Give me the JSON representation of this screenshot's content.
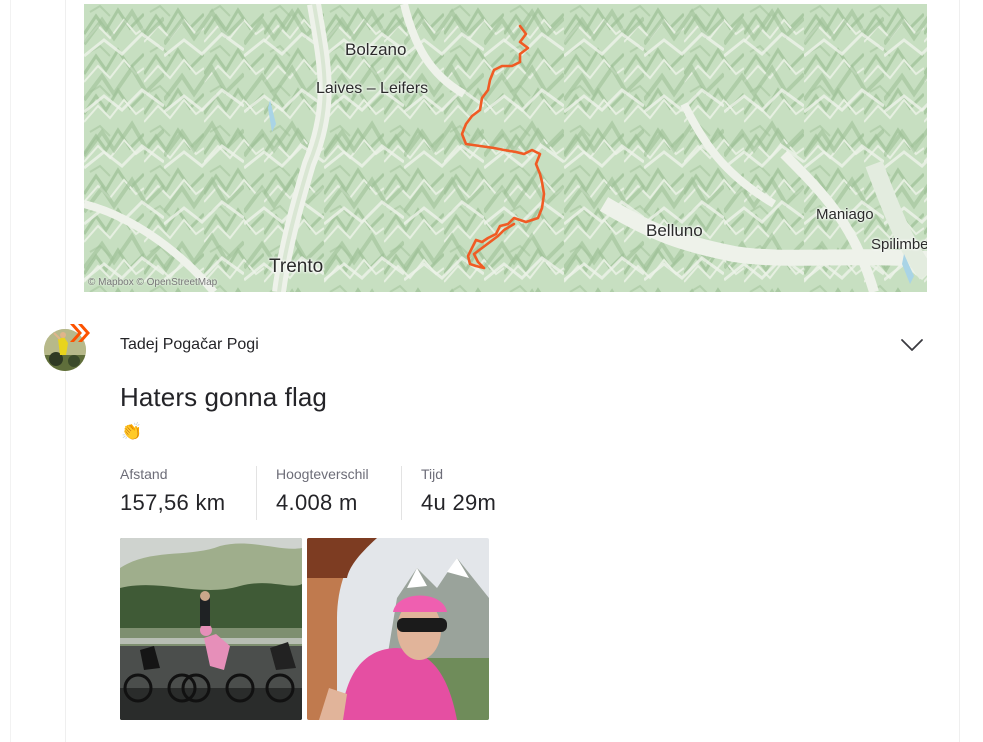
{
  "map": {
    "labels": {
      "bolzano": "Bolzano",
      "laives": "Laives – Leifers",
      "trento": "Trento",
      "belluno": "Belluno",
      "maniago": "Maniago",
      "spilimbergo": "Spilimbe"
    },
    "credit": "© Mapbox © OpenStreetMap",
    "route_color": "#f05b24"
  },
  "entry": {
    "athlete_name": "Tadej Pogačar Pogi",
    "title": "Haters gonna flag",
    "emoji": "👏",
    "stats": [
      {
        "label": "Afstand",
        "value": "157,56 km"
      },
      {
        "label": "Hoogteverschil",
        "value": "4.008 m"
      },
      {
        "label": "Tijd",
        "value": "4u 29m"
      }
    ],
    "options_icon": "chevron-down-icon",
    "brand_color": "#fc5200"
  },
  "photos": [
    {
      "icon": "photo-riders-mountain-road"
    },
    {
      "icon": "photo-rider-pink-jersey"
    }
  ]
}
